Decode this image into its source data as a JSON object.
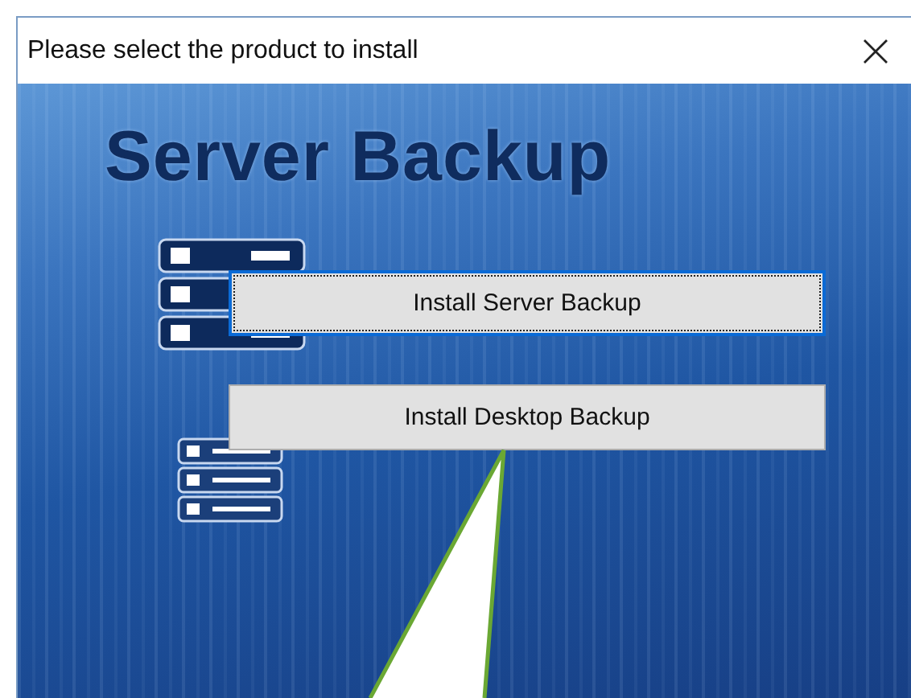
{
  "window": {
    "title": "Please select the product to install"
  },
  "banner": {
    "heading": "Server Backup"
  },
  "buttons": [
    {
      "label": "Install Server Backup",
      "focused": true
    },
    {
      "label": "Install Desktop Backup",
      "focused": false
    }
  ]
}
